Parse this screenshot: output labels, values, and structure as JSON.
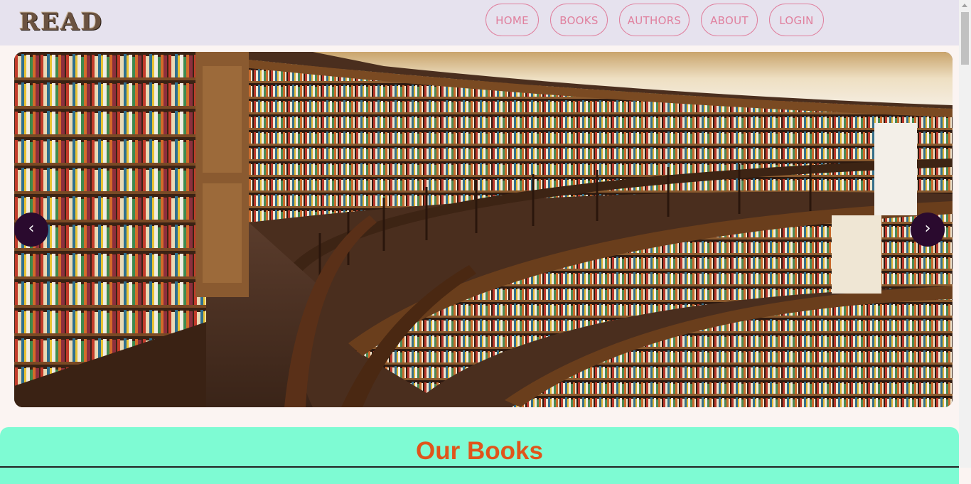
{
  "header": {
    "logo_text": "READ",
    "nav": [
      {
        "label": "HOME"
      },
      {
        "label": "BOOKS"
      },
      {
        "label": "AUTHORS"
      },
      {
        "label": "ABOUT"
      },
      {
        "label": "LOGIN"
      }
    ],
    "accent_color": "#e0809e"
  },
  "carousel": {
    "image": "library-bookshelves-photo",
    "prev_icon": "‹",
    "next_icon": "›",
    "button_color": "#2a0a2e"
  },
  "books_section": {
    "title": "Our Books",
    "background": "#7efbd3",
    "title_color": "#e0541b"
  }
}
